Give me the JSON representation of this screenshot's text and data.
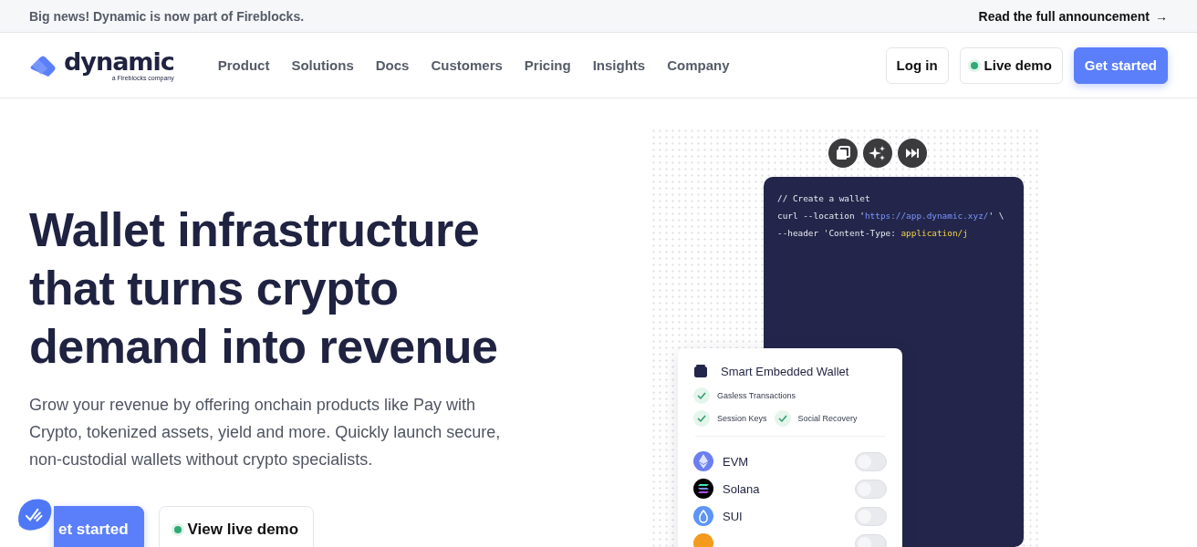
{
  "announcement": {
    "text": "Big news! Dynamic is now part of Fireblocks.",
    "link": "Read the full announcement",
    "link_arrow": "→"
  },
  "nav": {
    "brand": "dynamic",
    "brand_tagline": "a Fireblocks company",
    "links": [
      "Product",
      "Solutions",
      "Docs",
      "Customers",
      "Pricing",
      "Insights",
      "Company"
    ],
    "buttons": [
      {
        "label": "Log in",
        "kind": "outline"
      },
      {
        "label": "Live demo",
        "kind": "demo"
      },
      {
        "label": "Get started",
        "kind": "primary"
      }
    ]
  },
  "hero": {
    "title": "Wallet infrastructure that turns crypto demand into revenue",
    "subtitle": "Grow your revenue by offering onchain products like Pay with Crypto, tokenized assets, yield and more. Quickly launch secure, non-custodial wallets without crypto specialists.",
    "buttons": [
      {
        "label": "et started",
        "kind": "primary"
      },
      {
        "label": "View live demo",
        "kind": "demo"
      }
    ]
  },
  "code": {
    "lines": [
      [
        {
          "text": "// Create a wallet",
          "kind": "comment"
        }
      ],
      [
        {
          "text": "curl --location '",
          "kind": "plain"
        },
        {
          "text": "https://app.dynamic.xyz/",
          "kind": "url"
        },
        {
          "text": "' \\",
          "kind": "plain"
        }
      ],
      [
        {
          "text": "--header 'Content-Type: ",
          "kind": "plain"
        },
        {
          "text": "application/j",
          "kind": "string"
        }
      ]
    ]
  },
  "wallet_card": {
    "title": "Smart Embedded Wallet",
    "features": [
      [
        "Gasless Transactions"
      ],
      [
        "Session Keys",
        "Social Recovery"
      ]
    ],
    "chains": [
      {
        "name": "EVM",
        "kind": "evm",
        "on": false
      },
      {
        "name": "Solana",
        "kind": "solana",
        "on": false
      },
      {
        "name": "SUI",
        "kind": "sui",
        "on": false
      },
      {
        "kind": "coin",
        "on": false
      }
    ]
  }
}
